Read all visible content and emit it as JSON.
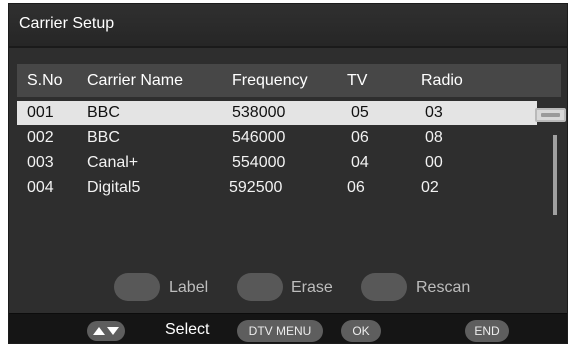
{
  "title": "Carrier Setup",
  "columns": {
    "sno": "S.No",
    "carrier_name": "Carrier Name",
    "frequency": "Frequency",
    "tv": "TV",
    "radio": "Radio"
  },
  "rows": [
    {
      "sno": "001",
      "name": "BBC",
      "frequency": "538000",
      "tv": "05",
      "radio": "03",
      "selected": true
    },
    {
      "sno": "002",
      "name": "BBC",
      "frequency": "546000",
      "tv": "06",
      "radio": "08",
      "selected": false
    },
    {
      "sno": "003",
      "name": "Canal+",
      "frequency": "554000",
      "tv": "04",
      "radio": "00",
      "selected": false
    },
    {
      "sno": "004",
      "name": "Digital5",
      "frequency": "592500",
      "tv": "06",
      "radio": "02",
      "selected": false
    }
  ],
  "actions": {
    "label": "Label",
    "erase": "Erase",
    "rescan": "Rescan"
  },
  "footer": {
    "select": "Select",
    "dtv_menu": "DTV MENU",
    "ok": "OK",
    "end": "END",
    "arrows_icon": "up-down-arrows-icon"
  },
  "colors": {
    "selected_row": "#e4e4e4",
    "window_bg": "#2e2e2e",
    "header_bg": "#474747"
  }
}
